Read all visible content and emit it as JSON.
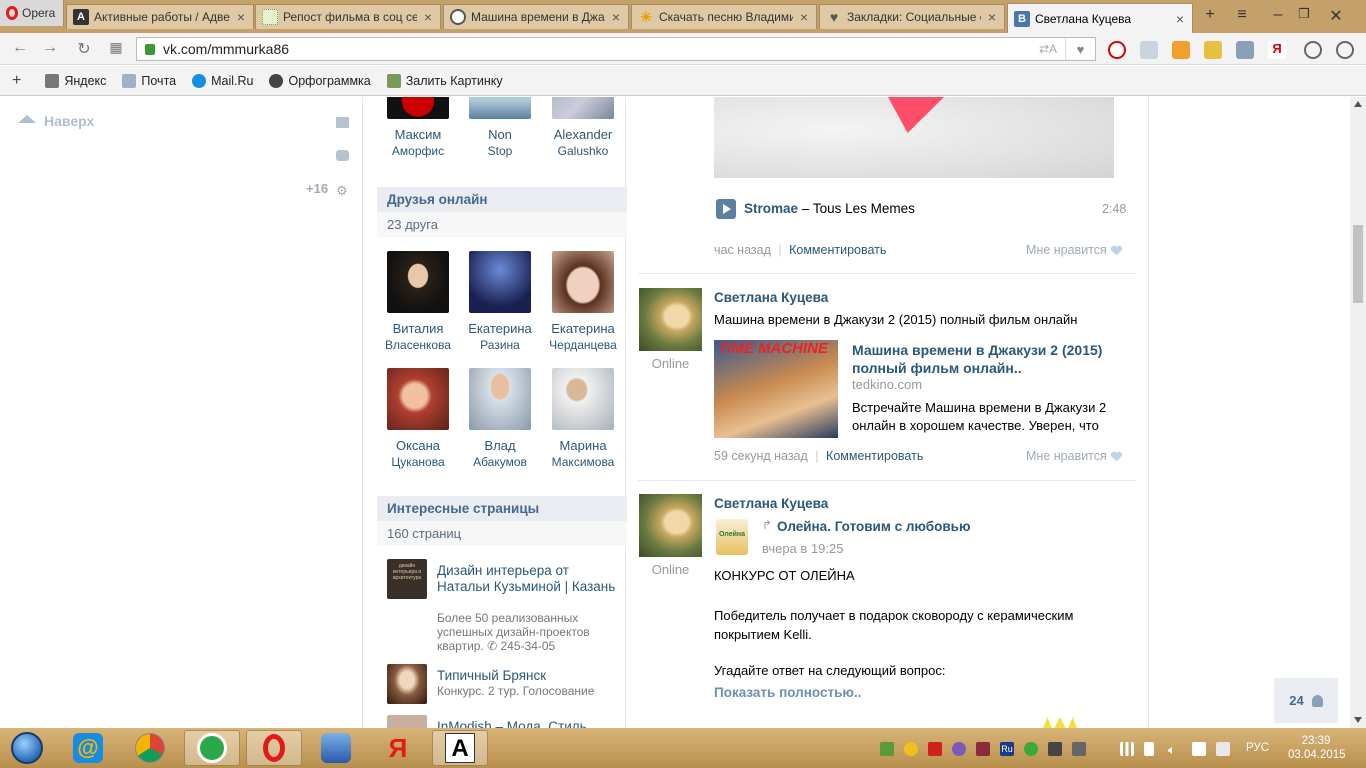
{
  "browser": {
    "menu_label": "Opera",
    "tabs": [
      {
        "title": "Активные работы / Адвего",
        "active": false
      },
      {
        "title": "Репост фильма в соц сетях",
        "active": false
      },
      {
        "title": "Машина времени в Джакузи",
        "active": false
      },
      {
        "title": "Скачать песню Владимир",
        "active": false
      },
      {
        "title": "Закладки: Социальные се",
        "active": false
      },
      {
        "title": "Светлана Куцева",
        "active": true
      }
    ],
    "url": "vk.com/mmmurka86",
    "bookmarks": [
      "Яндекс",
      "Почта",
      "Mail.Ru",
      "Орфограммка",
      "Залить Картинку"
    ]
  },
  "left": {
    "up_label": "Наверх",
    "count_label": "+16"
  },
  "friends_top": [
    {
      "first": "Максим",
      "last": "Аморфис"
    },
    {
      "first": "Non",
      "last": "Stop"
    },
    {
      "first": "Alexander",
      "last": "Galushko"
    }
  ],
  "friends_online": {
    "header": "Друзья онлайн",
    "count": "23 друга",
    "items": [
      {
        "first": "Виталия",
        "last": "Власенкова"
      },
      {
        "first": "Екатерина",
        "last": "Разина"
      },
      {
        "first": "Екатерина",
        "last": "Черданцева"
      },
      {
        "first": "Оксана",
        "last": "Цуканова"
      },
      {
        "first": "Влад",
        "last": "Абакумов"
      },
      {
        "first": "Марина",
        "last": "Максимова"
      }
    ]
  },
  "pages": {
    "header": "Интересные страницы",
    "count": "160 страниц",
    "items": [
      {
        "title": "Дизайн интерьера от Натальи Кузьминой | Казань",
        "desc": "Более 50 реализованных успешных дизайн-проектов квартир. ✆ 245-34-05",
        "logo_text": "дизайн интерьера и архитектура"
      },
      {
        "title": "Типичный Брянск",
        "desc": "Конкурс. 2 тур. Голосование"
      },
      {
        "title": "InModish – Мода. Стиль.",
        "desc": ""
      }
    ]
  },
  "wall": {
    "audio": {
      "artist": "Stromae",
      "dash": "–",
      "title": "Tous Les Memes",
      "duration": "2:48"
    },
    "post0": {
      "time": "час назад",
      "comment": "Комментировать",
      "like": "Мне нравится"
    },
    "post1": {
      "author": "Светлана Куцева",
      "status": "Online",
      "text": "Машина времени в Джакузи 2 (2015) полный фильм онлайн",
      "link_title": "Машина времени в Джакузи 2 (2015) полный фильм онлайн..",
      "link_domain": "tedkino.com",
      "link_desc": "Встречайте Машина времени в Джакузи 2 онлайн в хорошем качестве. Уверен, что",
      "poster_text": "TIME MACHINE",
      "time": "59 секунд назад",
      "comment": "Комментировать",
      "like": "Мне нравится"
    },
    "post2": {
      "author": "Светлана Куцева",
      "status": "Online",
      "repost_from": "Олейна. Готовим с любовью",
      "repost_time": "вчера в 19:25",
      "repost_logo": "Олейна",
      "line1": "КОНКУРС ОТ ОЛЕЙНА",
      "line2": "Победитель получает в подарок сковороду с керамическим покрытием Kelli.",
      "line3": "Угадайте ответ на следующий вопрос:",
      "more": "Показать полностью.."
    }
  },
  "online_counter": "24",
  "taskbar": {
    "lang": "РУС",
    "time": "23:39",
    "date": "03.04.2015",
    "tray_ru": "Ru",
    "yandex_glyph": "Я",
    "font_glyph": "A"
  },
  "colors": {
    "vk_blue": "#2b587a",
    "header_bg": "#e9edf2",
    "taskbar": "#c9a263",
    "tabbar": "#c4a06a"
  }
}
